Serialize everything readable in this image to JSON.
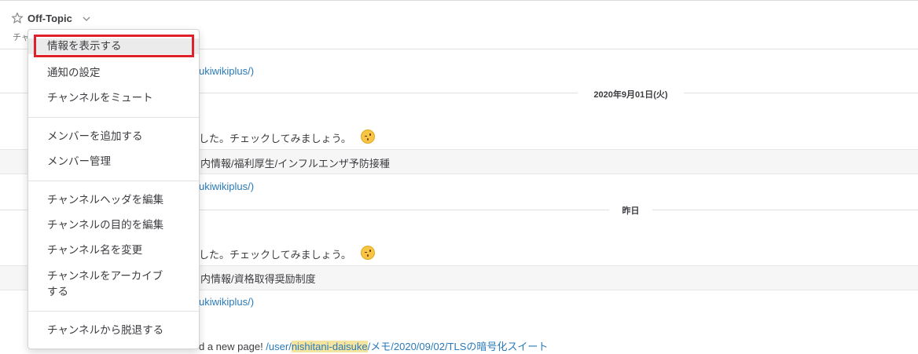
{
  "header": {
    "channel_name": "Off-Topic",
    "purpose_fragment": "チャ"
  },
  "messages": {
    "link_fragment_1": "ukiwikiplus/)",
    "date_1": "2020年9月01日(火)",
    "message_fragment_1": "した。チェックしてみましょう。",
    "attachment_1": "内情報/福利厚生/インフルエンザ予防接種",
    "link_fragment_2": "ukiwikiplus/)",
    "date_2": "昨日",
    "message_fragment_2": "した。チェックしてみましょう。",
    "attachment_2": "内情報/資格取得奨励制度",
    "link_fragment_3": "ukiwikiplus/)",
    "bottom_prefix": "d a new page! ",
    "bottom_link_a": "/user/",
    "bottom_link_user": "nishitani-daisuke",
    "bottom_link_b": "/メモ/2020/09/02/TLSの暗号化スイート"
  },
  "menu": {
    "items": [
      {
        "label": "情報を表示する"
      },
      {
        "label": "通知の設定"
      },
      {
        "label": "チャンネルをミュート"
      },
      {
        "label": "メンバーを追加する"
      },
      {
        "label": "メンバー管理"
      },
      {
        "label": "チャンネルヘッダを編集"
      },
      {
        "label": "チャンネルの目的を編集"
      },
      {
        "label": "チャンネル名を変更"
      },
      {
        "label": "チャンネルをアーカイブ"
      },
      {
        "label": "する"
      },
      {
        "label": "チャンネルから脱退する"
      }
    ]
  },
  "colors": {
    "link": "#2a7ab8",
    "highlight_border": "#e0212b",
    "mention_highlight": "#f5e3a0"
  },
  "icons": {
    "star": "star-outline-icon",
    "chevron": "chevron-down-icon",
    "emoji": "winking-face-emoji-icon"
  }
}
